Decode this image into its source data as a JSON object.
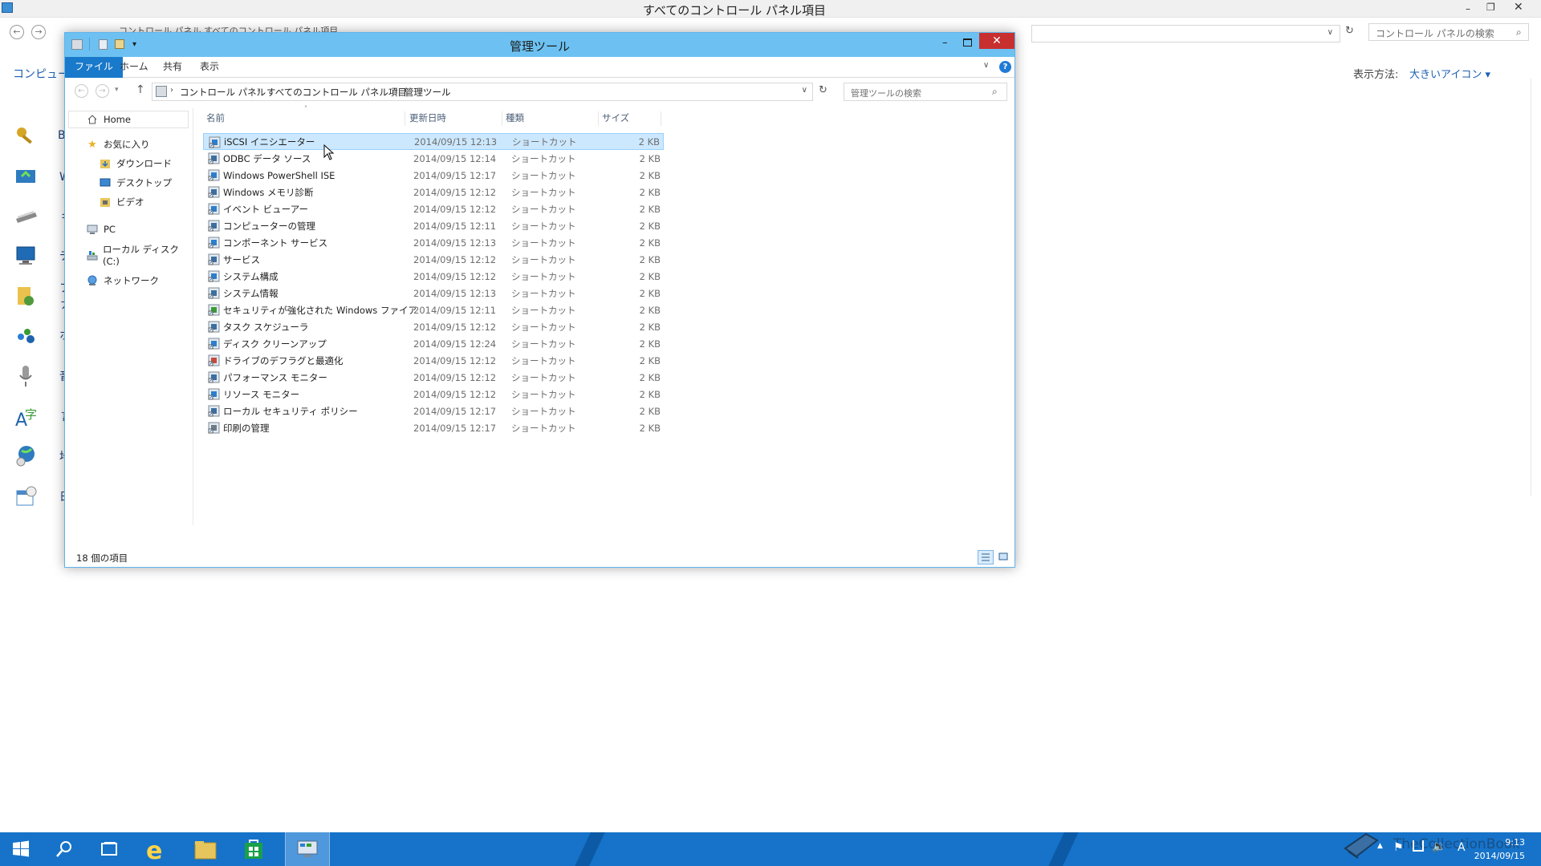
{
  "background": {
    "title": "すべてのコントロール パネル項目",
    "breadcrumb_partial": "コントロール パネル  すべてのコントロール パネル項目",
    "search_placeholder": "コントロール パネルの検索",
    "view_label": "表示方法:",
    "view_value": "大きいアイコン ▾",
    "left_heading_partial": "コンピュータ",
    "items": [
      "Bit",
      "Wi",
      "キ",
      "デ",
      "ファ",
      "ホ",
      "音",
      "言",
      "地",
      "日"
    ]
  },
  "window": {
    "title": "管理ツール",
    "ribbon_tabs": [
      "ファイル",
      "ホーム",
      "共有",
      "表示"
    ],
    "address": [
      "コントロール パネル",
      "すべてのコントロール パネル項目",
      "管理ツール"
    ],
    "search_placeholder": "管理ツールの検索",
    "sidebar": {
      "home": "Home",
      "favorites": "お気に入り",
      "downloads": "ダウンロード",
      "desktop": "デスクトップ",
      "videos": "ビデオ",
      "pc": "PC",
      "local_disk": "ローカル ディスク (C:)",
      "network": "ネットワーク"
    },
    "columns": {
      "name": "名前",
      "date": "更新日時",
      "type": "種類",
      "size": "サイズ"
    },
    "files": [
      {
        "name": "iSCSI イニシエーター",
        "date": "2014/09/15 12:13",
        "type": "ショートカット",
        "size": "2 KB"
      },
      {
        "name": "ODBC データ ソース",
        "date": "2014/09/15 12:14",
        "type": "ショートカット",
        "size": "2 KB"
      },
      {
        "name": "Windows PowerShell ISE",
        "date": "2014/09/15 12:17",
        "type": "ショートカット",
        "size": "2 KB"
      },
      {
        "name": "Windows メモリ診断",
        "date": "2014/09/15 12:12",
        "type": "ショートカット",
        "size": "2 KB"
      },
      {
        "name": "イベント ビューアー",
        "date": "2014/09/15 12:12",
        "type": "ショートカット",
        "size": "2 KB"
      },
      {
        "name": "コンピューターの管理",
        "date": "2014/09/15 12:11",
        "type": "ショートカット",
        "size": "2 KB"
      },
      {
        "name": "コンポーネント サービス",
        "date": "2014/09/15 12:13",
        "type": "ショートカット",
        "size": "2 KB"
      },
      {
        "name": "サービス",
        "date": "2014/09/15 12:12",
        "type": "ショートカット",
        "size": "2 KB"
      },
      {
        "name": "システム構成",
        "date": "2014/09/15 12:12",
        "type": "ショートカット",
        "size": "2 KB"
      },
      {
        "name": "システム情報",
        "date": "2014/09/15 12:13",
        "type": "ショートカット",
        "size": "2 KB"
      },
      {
        "name": "セキュリティが強化された Windows ファイアウ...",
        "date": "2014/09/15 12:11",
        "type": "ショートカット",
        "size": "2 KB"
      },
      {
        "name": "タスク スケジューラ",
        "date": "2014/09/15 12:12",
        "type": "ショートカット",
        "size": "2 KB"
      },
      {
        "name": "ディスク クリーンアップ",
        "date": "2014/09/15 12:24",
        "type": "ショートカット",
        "size": "2 KB"
      },
      {
        "name": "ドライブのデフラグと最適化",
        "date": "2014/09/15 12:12",
        "type": "ショートカット",
        "size": "2 KB"
      },
      {
        "name": "パフォーマンス モニター",
        "date": "2014/09/15 12:12",
        "type": "ショートカット",
        "size": "2 KB"
      },
      {
        "name": "リソース モニター",
        "date": "2014/09/15 12:12",
        "type": "ショートカット",
        "size": "2 KB"
      },
      {
        "name": "ローカル セキュリティ ポリシー",
        "date": "2014/09/15 12:17",
        "type": "ショートカット",
        "size": "2 KB"
      },
      {
        "name": "印刷の管理",
        "date": "2014/09/15 12:17",
        "type": "ショートカット",
        "size": "2 KB"
      }
    ],
    "status": "18 個の項目"
  },
  "taskbar": {
    "time": "9:13",
    "date": "2014/09/15",
    "ime": "A",
    "watermark": "TheCollectionBook"
  },
  "colors": {
    "title_active": "#6cc1f2",
    "file_tab": "#1979ca",
    "selection": "#cce8ff",
    "taskbar": "#1673c9",
    "close": "#c7302e"
  }
}
